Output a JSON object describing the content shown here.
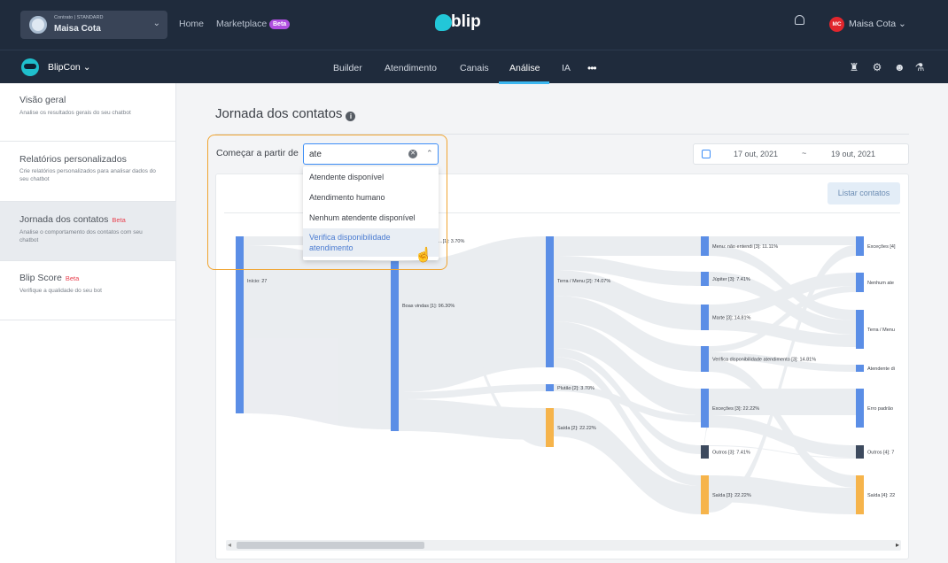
{
  "topbar": {
    "account_plan": "Contrato | STANDARD",
    "account_name": "Maisa Cota",
    "nav_home": "Home",
    "nav_marketplace": "Marketplace",
    "marketplace_badge": "Beta",
    "logo_text": "blip",
    "user_initials": "MC",
    "user_name": "Maisa Cota"
  },
  "subbar": {
    "bot_name": "BlipCon",
    "tabs": [
      "Builder",
      "Atendimento",
      "Canais",
      "Análise",
      "IA"
    ],
    "active_tab": "Análise",
    "more": "•••"
  },
  "sidebar": {
    "items": [
      {
        "title": "Visão geral",
        "desc": "Analise os resultados gerais do seu chatbot"
      },
      {
        "title": "Relatórios personalizados",
        "desc": "Crie relatórios personalizados para analisar dados do seu chatbot"
      },
      {
        "title": "Jornada dos contatos",
        "badge": "Beta",
        "desc": "Analise o comportamento dos contatos com seu chatbot"
      },
      {
        "title": "Blip Score",
        "badge": "Beta",
        "desc": "Verifique a qualidade do seu bot"
      }
    ]
  },
  "content": {
    "heading": "Jornada dos contatos",
    "start_label": "Começar a partir de",
    "search_value": "ate",
    "options": [
      "Atendente disponível",
      "Atendimento humano",
      "Nenhum atendente disponível",
      "Verifica disponibilidade atendimento"
    ],
    "hovered_option": "Verifica disponibilidade atendimento",
    "date_from": "17 out, 2021",
    "date_sep": "~",
    "date_to": "19 out, 2021",
    "list_button": "Listar contatos"
  },
  "colors": {
    "node_blue": "#5b8ee6",
    "node_dark": "#3d4a5e",
    "node_orange": "#f6b44b",
    "link_gray": "#e7eaee",
    "highlight_border": "#f0a430"
  },
  "chart_data": {
    "type": "sankey",
    "nodes": [
      {
        "label": "Início: 27",
        "column": 1
      },
      {
        "label": "Boas vindas [1]: 96.30%",
        "column": 2
      },
      {
        "label": "...[1]: 3.70%",
        "column": 2
      },
      {
        "label": "Terra / Menu [2]: 74.07%",
        "column": 3
      },
      {
        "label": "Plutão [2]: 3.70%",
        "column": 3
      },
      {
        "label": "Saída [2]: 22.22%",
        "column": 3
      },
      {
        "label": "Menu: não entendi [3]: 11.11%",
        "column": 4
      },
      {
        "label": "Júpiter [3]: 7.41%",
        "column": 4
      },
      {
        "label": "Marte [3]: 14.81%",
        "column": 4
      },
      {
        "label": "Verifica disponibilidade atendimento [3]: 14.81%",
        "column": 4
      },
      {
        "label": "Exceções [3]: 22.22%",
        "column": 4
      },
      {
        "label": "Outros [3]: 7.41%",
        "column": 4
      },
      {
        "label": "Saída [3]: 22.22%",
        "column": 4
      },
      {
        "label": "Exceções [4]",
        "column": 5
      },
      {
        "label": "Nenhum ate",
        "column": 5
      },
      {
        "label": "Terra / Menu",
        "column": 5
      },
      {
        "label": "Atendente di",
        "column": 5
      },
      {
        "label": "Erro padrão",
        "column": 5
      },
      {
        "label": "Outros [4]: 7",
        "column": 5
      },
      {
        "label": "Saída [4]: 22",
        "column": 5
      }
    ]
  }
}
